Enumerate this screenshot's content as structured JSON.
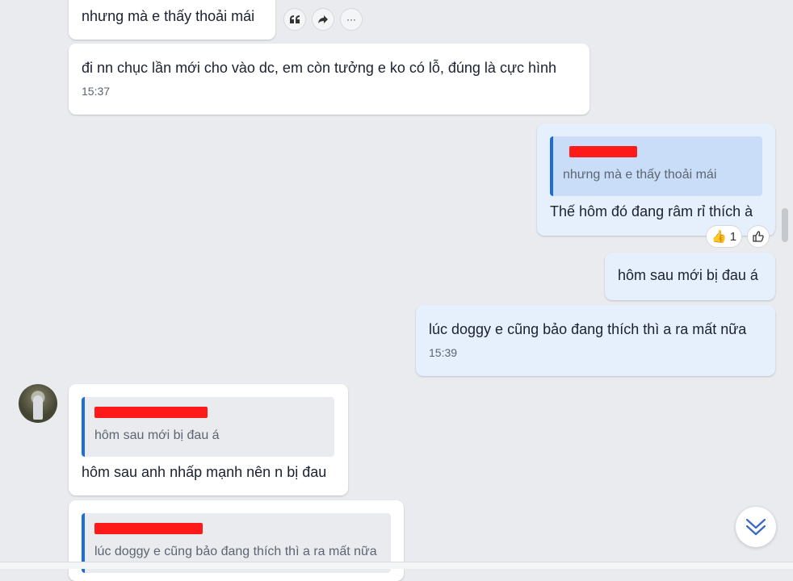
{
  "messages": [
    {
      "text": "nhưng mà e thấy thoải mái"
    },
    {
      "text": "đi nn chục lần mới cho vào dc, em còn tưởng e ko có lỗ, đúng là cực hình",
      "time": "15:37"
    },
    {
      "quote": "nhưng mà e thấy thoải mái",
      "text": "Thế hôm đó đang râm rỉ thích à",
      "reaction": {
        "emoji": "👍",
        "count": "1"
      }
    },
    {
      "text": "hôm sau mới bị đau á"
    },
    {
      "text": "lúc doggy e cũng bảo đang thích thì a ra mất nữa",
      "time": "15:39"
    },
    {
      "quote": "hôm sau mới bị đau á",
      "text": "hôm sau anh nhấp mạnh nên n bị đau"
    },
    {
      "quote": "lúc doggy e cũng bảo đang thích thì a ra mất nữa"
    }
  ],
  "actions": {
    "more": "···"
  },
  "colors": {
    "outgoing": "#e6f0fd",
    "incoming": "#ffffff",
    "accent": "#1a6ddb",
    "redaction": "#ff1a1a"
  }
}
